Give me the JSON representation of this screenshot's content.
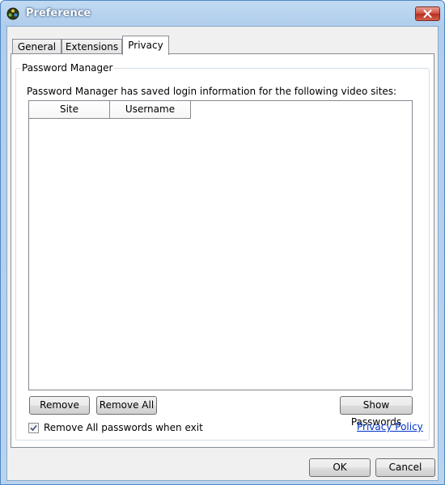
{
  "window": {
    "title": "Preference"
  },
  "tabs": [
    {
      "label": "General",
      "active": false
    },
    {
      "label": "Extensions",
      "active": false
    },
    {
      "label": "Privacy",
      "active": true
    }
  ],
  "password_manager": {
    "group_title": "Password Manager",
    "description": "Password Manager has saved login information for the following video sites:",
    "columns": [
      "Site",
      "Username"
    ],
    "rows": [],
    "buttons": {
      "remove": "Remove",
      "remove_all": "Remove All",
      "show_passwords": "Show Passwords"
    },
    "checkbox": {
      "label": "Remove All passwords when exit",
      "checked": true
    },
    "privacy_link": "Privacy Policy"
  },
  "footer": {
    "ok": "OK",
    "cancel": "Cancel"
  },
  "colors": {
    "titlebar": "#b0cdec",
    "close_button": "#cd4a3a",
    "link": "#0033cc"
  },
  "icons": {
    "app": "film-reel-icon",
    "close": "close-icon",
    "check": "checkmark-icon"
  }
}
